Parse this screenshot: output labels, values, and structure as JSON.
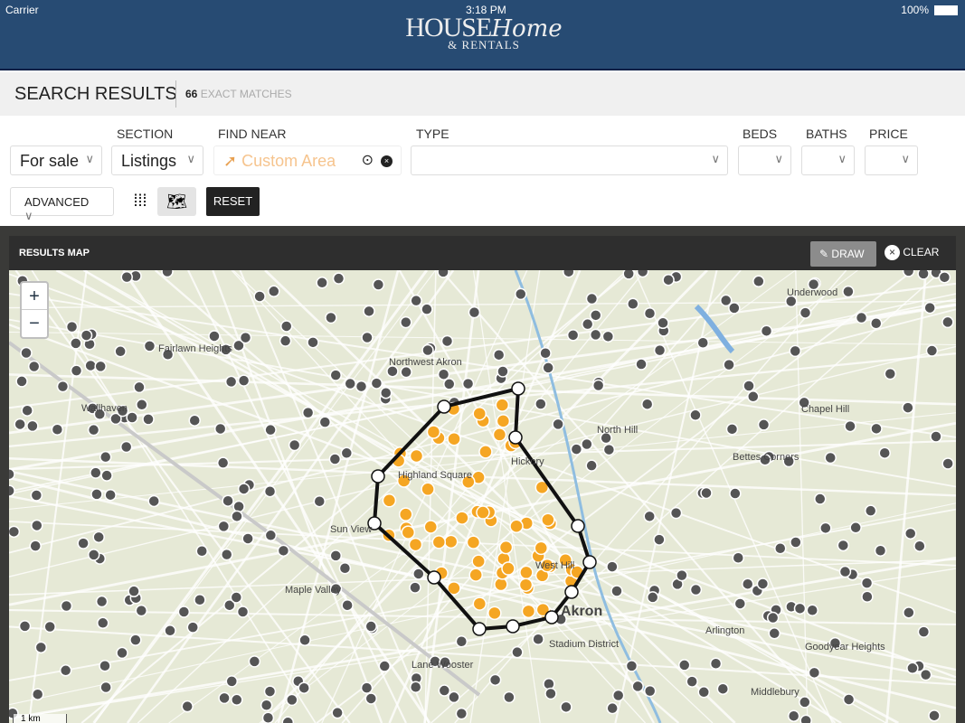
{
  "status": {
    "carrier": "Carrier",
    "time": "3:18 PM",
    "battery": "100%"
  },
  "logo": {
    "line1": "HOUSE",
    "line2": "Home",
    "line3": "& RENTALS"
  },
  "header": {
    "title": "SEARCH RESULTS",
    "count": "66",
    "count_label": "EXACT MATCHES"
  },
  "filters": {
    "section_label": "SECTION",
    "find_near_label": "FIND NEAR",
    "type_label": "TYPE",
    "beds_label": "BEDS",
    "baths_label": "BATHS",
    "price_label": "PRICE",
    "sale_value": "For sale",
    "section_value": "Listings",
    "find_near_value": "Custom Area",
    "advanced": "ADVANCED",
    "reset": "RESET"
  },
  "map": {
    "title": "RESULTS MAP",
    "draw": "DRAW",
    "clear": "CLEAR",
    "zoom_in": "+",
    "zoom_out": "−",
    "scale": "1 km",
    "labels": [
      "Northwest Akron",
      "Fairlawn Heights",
      "Wallhaven",
      "Chapel Hill",
      "Bettes Corners",
      "North Hill",
      "Highland Square",
      "Maple Valley",
      "Akron",
      "Stadium District",
      "Lane Wooster",
      "Goodyear Heights",
      "Middlebury",
      "Arlington",
      "Underwood",
      "Hickory",
      "West Hill",
      "Sun View"
    ],
    "accent": "#f5a623",
    "selected_count": 66
  }
}
